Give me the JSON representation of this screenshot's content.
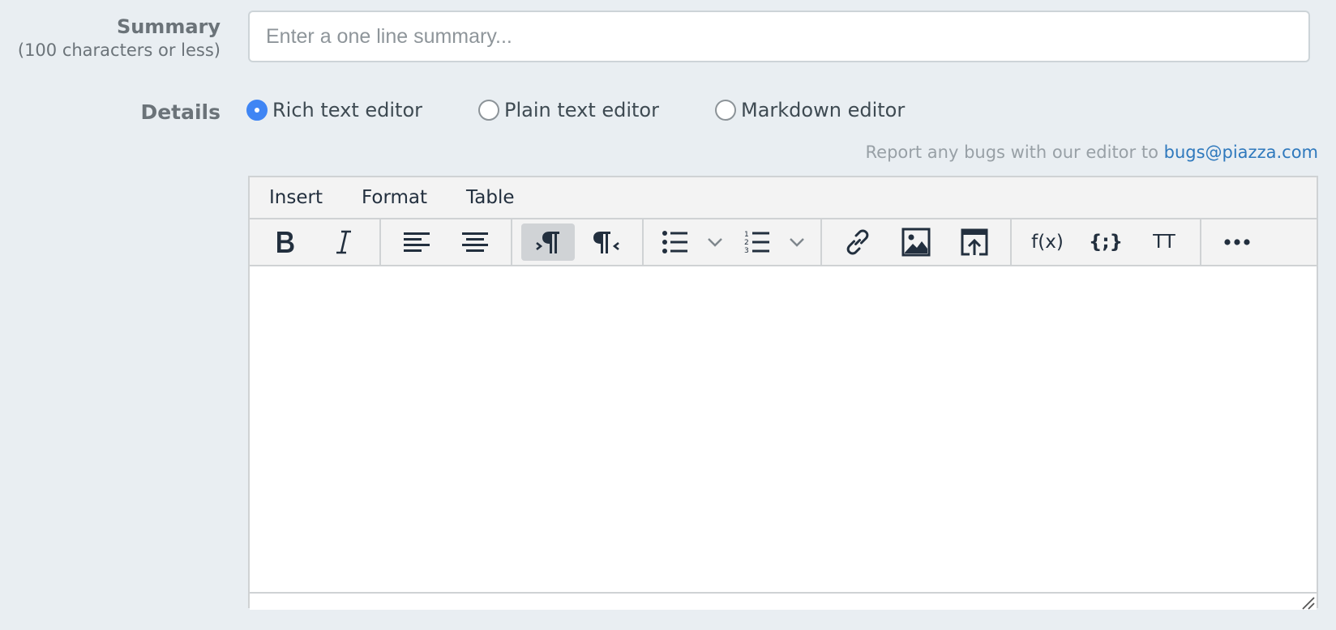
{
  "summary": {
    "label": "Summary",
    "sublabel": "(100 characters or less)",
    "placeholder": "Enter a one line summary...",
    "value": ""
  },
  "details": {
    "label": "Details",
    "editor_options": [
      {
        "label": "Rich text editor",
        "checked": true
      },
      {
        "label": "Plain text editor",
        "checked": false
      },
      {
        "label": "Markdown editor",
        "checked": false
      }
    ],
    "report_text": "Report any bugs with our editor to ",
    "report_link": "bugs@piazza.com"
  },
  "editor": {
    "menus": [
      "Insert",
      "Format",
      "Table"
    ],
    "toolbar_icons": [
      "bold-icon",
      "italic-icon",
      "align-left-icon",
      "align-center-icon",
      "ltr-icon",
      "rtl-icon",
      "bullet-list-icon",
      "numbered-list-icon",
      "link-icon",
      "image-icon",
      "upload-icon",
      "formula-icon",
      "code-icon",
      "tt-icon",
      "more-icon"
    ],
    "formula_label": "f(x)",
    "code_label": "{;}",
    "tt_label": "TT",
    "active_tool": "ltr-icon",
    "content": ""
  },
  "colors": {
    "background": "#e9eef2",
    "radio_checked": "#3f85f4",
    "link": "#2f79bd"
  }
}
